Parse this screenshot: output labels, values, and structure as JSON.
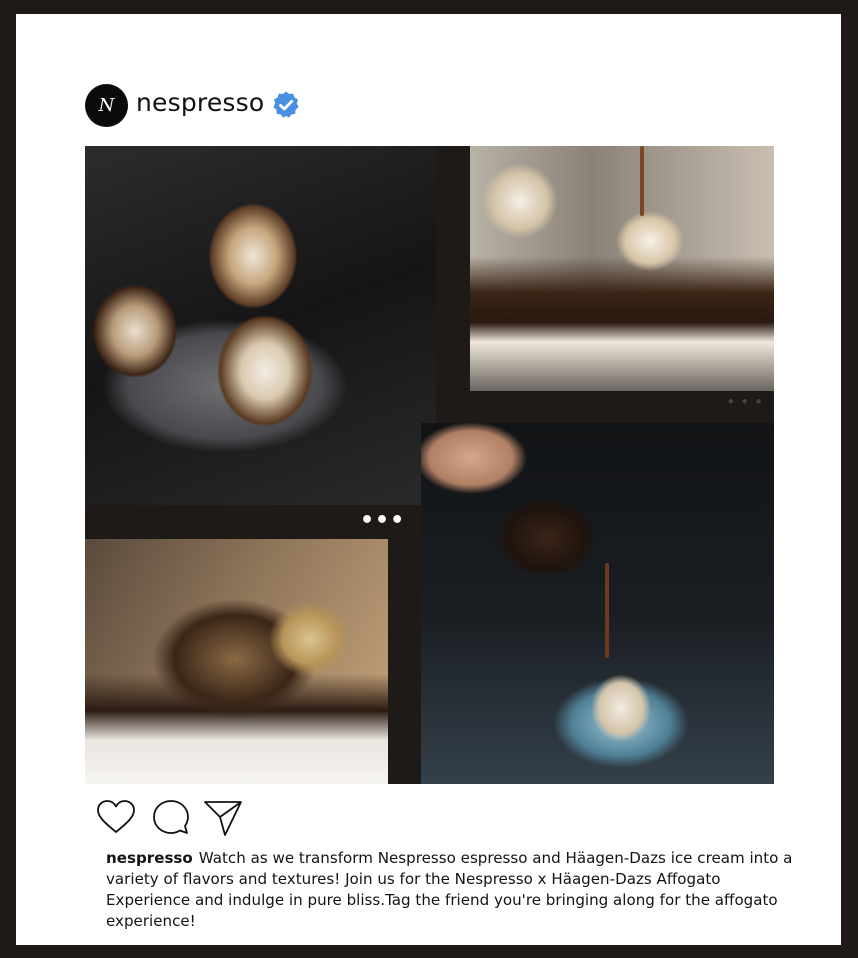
{
  "post": {
    "username": "nespresso",
    "avatar_letter": "N",
    "caption_user": "nespresso",
    "caption_text": "Watch as we transform Nespresso espresso and Häagen-Dazs ice cream into a variety of flavors and textures! Join us for the Nespresso x Häagen-Dazs Affogato Experience and indulge in pure bliss.Tag the friend you're bringing along for the affogato experience!",
    "more_dots_left": "•••",
    "more_dots_right": "• • •"
  },
  "icons": {
    "verified": "verified-badge-icon",
    "like": "heart-icon",
    "comment": "comment-bubble-icon",
    "share": "paper-plane-icon"
  },
  "colors": {
    "frame": "#1f1a18",
    "verified_blue": "#4a90e2",
    "mosaic_bg": "#1e1a17"
  }
}
